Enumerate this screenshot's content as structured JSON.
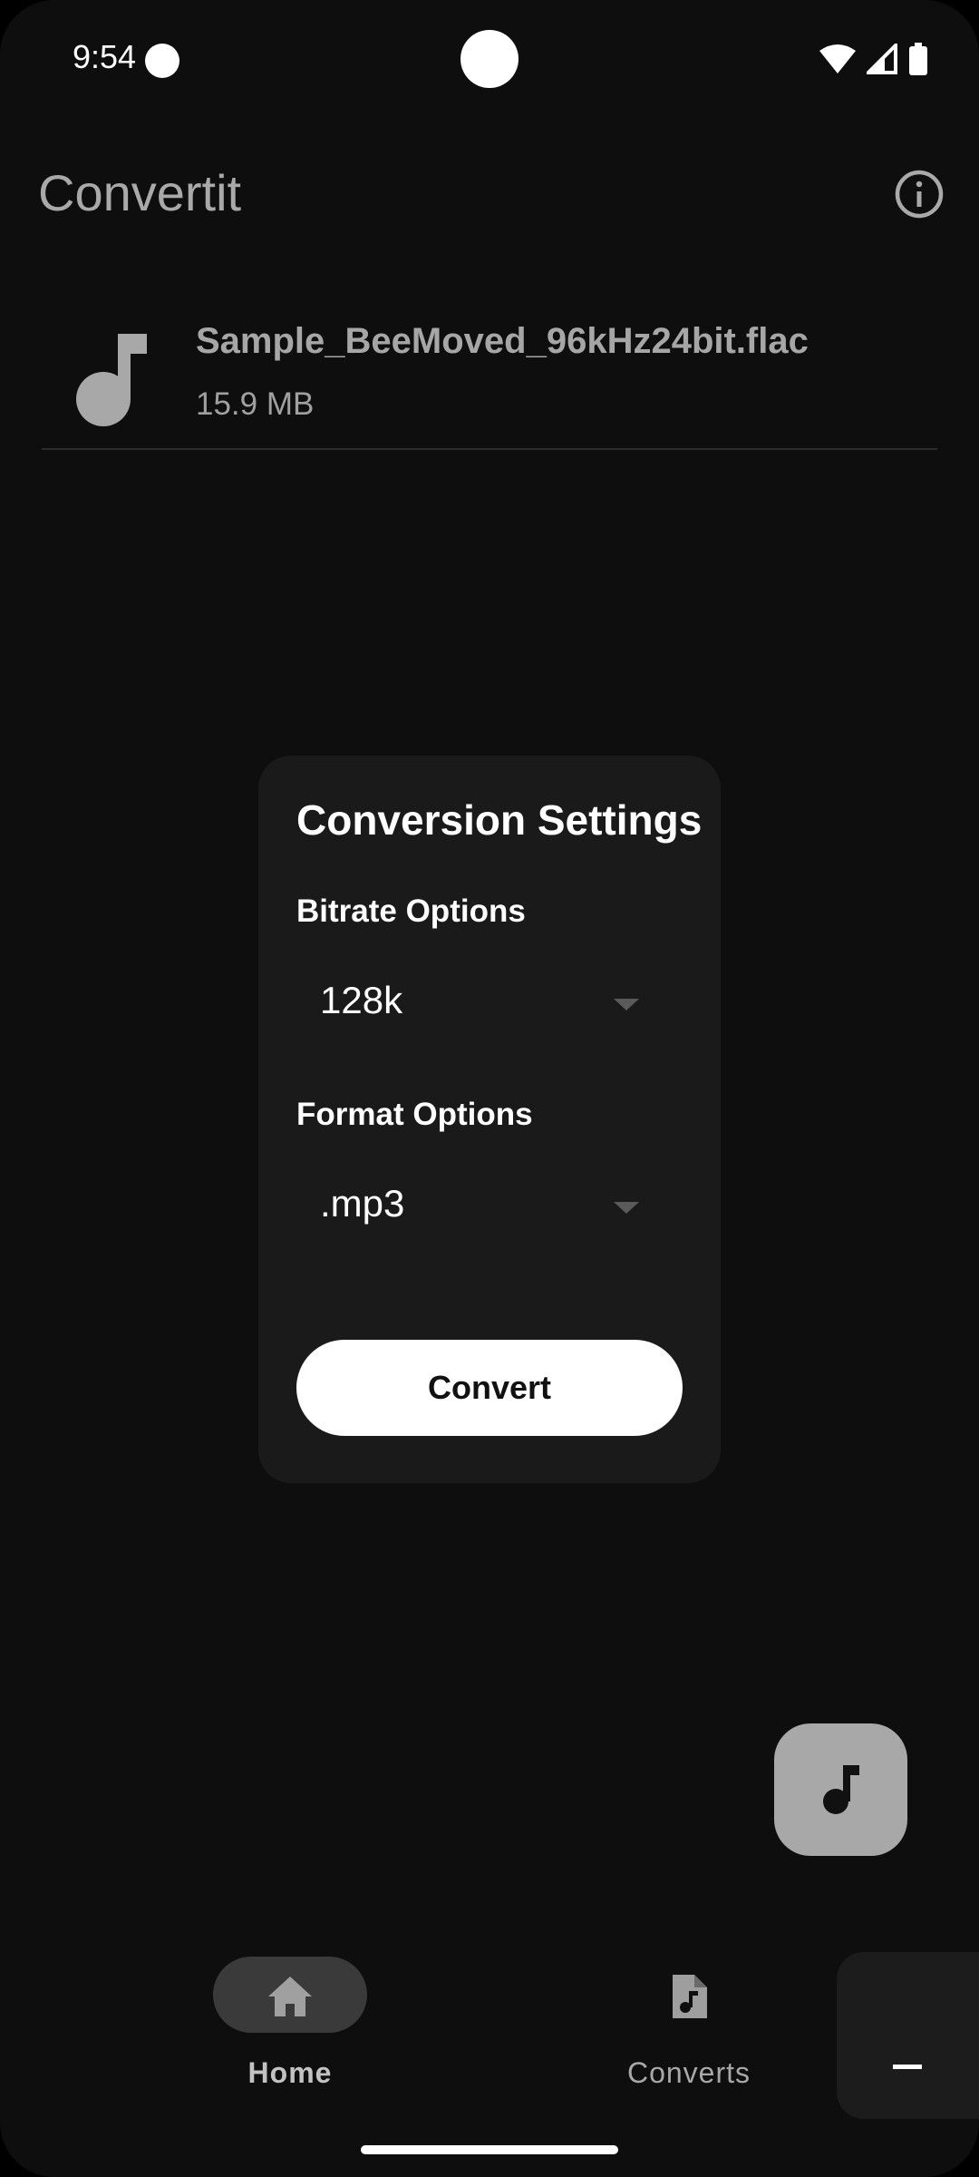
{
  "status_bar": {
    "time": "9:54",
    "icons": [
      "notification-dot",
      "wifi-icon",
      "signal-icon",
      "battery-icon"
    ]
  },
  "app_bar": {
    "title": "Convertit",
    "action_icon": "info-icon"
  },
  "file": {
    "icon": "music-note-icon",
    "name": "Sample_BeeMoved_96kHz24bit.flac",
    "size": "15.9 MB"
  },
  "dialog": {
    "title": "Conversion Settings",
    "bitrate_label": "Bitrate Options",
    "bitrate_value": "128k",
    "format_label": "Format Options",
    "format_value": ".mp3",
    "convert_label": "Convert"
  },
  "fab": {
    "icon": "music-note-icon"
  },
  "bottom_nav": {
    "items": [
      {
        "label": "Home",
        "icon": "home-icon",
        "selected": true
      },
      {
        "label": "Converts",
        "icon": "audio-file-icon",
        "selected": false
      }
    ]
  },
  "colors": {
    "background": "#0e0e0e",
    "dialog": "#1a1a1a",
    "fab": "#a8a8a8",
    "nav_pill": "#3a3a3a"
  }
}
